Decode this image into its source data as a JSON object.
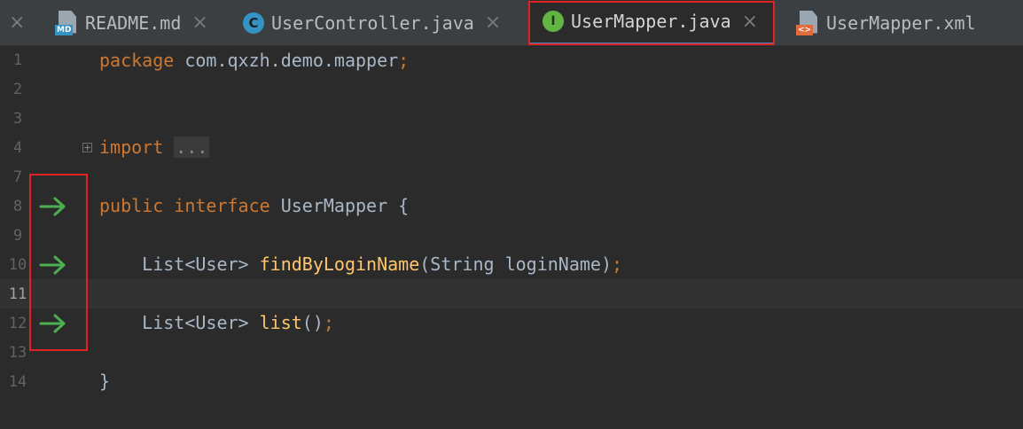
{
  "tabs": [
    {
      "label": "README.md",
      "icon": "markdown-file-icon",
      "icon_text": "MD",
      "close": "×"
    },
    {
      "label": "UserController.java",
      "icon": "class-icon",
      "icon_text": "C",
      "close": "×"
    },
    {
      "label": "UserMapper.java",
      "icon": "interface-icon",
      "icon_text": "I",
      "close": "×",
      "active": true
    },
    {
      "label": "UserMapper.xml",
      "icon": "xml-file-icon",
      "icon_text": "<>",
      "close": ""
    }
  ],
  "edge_close": "×",
  "gutter": {
    "line_numbers": [
      "1",
      "2",
      "3",
      "4",
      "7",
      "8",
      "9",
      "10",
      "11",
      "12",
      "13",
      "14"
    ],
    "current_line": "11",
    "fold_marker": "⊞",
    "impl_arrows": [
      "8",
      "10",
      "12"
    ]
  },
  "code": {
    "l1_kw": "package",
    "l1_rest": " com.qxzh.demo.mapper",
    "l1_semi": ";",
    "l4_kw": "import",
    "l4_fold": "...",
    "l8_kw1": "public",
    "l8_kw2": "interface",
    "l8_name": " UserMapper {",
    "l10_type": "List<User> ",
    "l10_fn": "findByLoginName",
    "l10_args": "(String loginName)",
    "l10_semi": ";",
    "l12_type": "List<User> ",
    "l12_fn": "list",
    "l12_args": "()",
    "l12_semi": ";",
    "l14": "}"
  },
  "colors": {
    "background": "#2b2b2b",
    "keyword": "#cc7832",
    "function": "#ffc66d",
    "text": "#a9b7c6",
    "arrow": "#4caf50",
    "highlight_box": "#e02424"
  }
}
